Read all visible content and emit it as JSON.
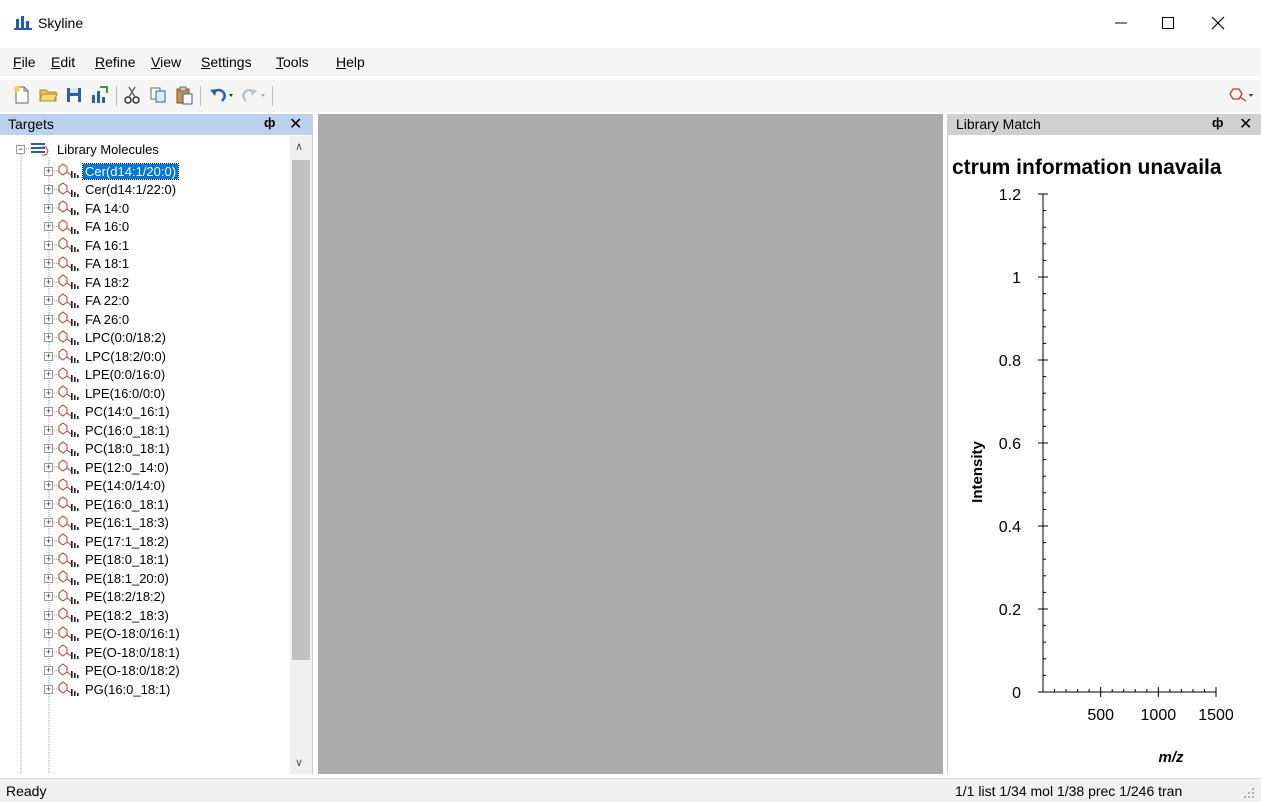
{
  "app": {
    "title": "Skyline"
  },
  "menu": [
    {
      "label": "File",
      "key": "F",
      "rest": "ile"
    },
    {
      "label": "Edit",
      "key": "E",
      "rest": "dit"
    },
    {
      "label": "Refine",
      "key": "R",
      "rest": "efine"
    },
    {
      "label": "View",
      "key": "V",
      "rest": "iew"
    },
    {
      "label": "Settings",
      "key": "S",
      "rest": "ettings"
    },
    {
      "label": "Tools",
      "key": "T",
      "rest": "ools"
    },
    {
      "label": "Help",
      "key": "H",
      "rest": "elp"
    }
  ],
  "toolbar": {
    "icons": [
      "new-document-icon",
      "open-folder-icon",
      "save-icon",
      "import-icon",
      "cut-icon",
      "copy-icon",
      "paste-icon",
      "undo-icon",
      "redo-icon",
      "molecule-mode-icon"
    ]
  },
  "targets_panel": {
    "title": "Targets",
    "pin": "ф",
    "close": "✕",
    "root_label": "Library Molecules",
    "items": [
      "Cer(d14:1/20:0)",
      "Cer(d14:1/22:0)",
      "FA 14:0",
      "FA 16:0",
      "FA 16:1",
      "FA 18:1",
      "FA 18:2",
      "FA 22:0",
      "FA 26:0",
      "LPC(0:0/18:2)",
      "LPC(18:2/0:0)",
      "LPE(0:0/16:0)",
      "LPE(16:0/0:0)",
      "PC(14:0_16:1)",
      "PC(16:0_18:1)",
      "PC(18:0_18:1)",
      "PE(12:0_14:0)",
      "PE(14:0/14:0)",
      "PE(16:0_18:1)",
      "PE(16:1_18:3)",
      "PE(17:1_18:2)",
      "PE(18:0_18:1)",
      "PE(18:1_20:0)",
      "PE(18:2/18:2)",
      "PE(18:2_18:3)",
      "PE(O-18:0/16:1)",
      "PE(O-18:0/18:1)",
      "PE(O-18:0/18:2)",
      "PG(16:0_18:1)"
    ],
    "selected_index": 0
  },
  "library_panel": {
    "title": "Library Match",
    "pin": "ф",
    "close": "✕"
  },
  "chart_data": {
    "type": "line",
    "title": "ctrum information unavaila",
    "xlabel": "m/z",
    "ylabel": "Intensity",
    "xlim": [
      0,
      1500
    ],
    "ylim": [
      0,
      1.2
    ],
    "xticks": [
      500,
      1000,
      1500
    ],
    "xtick_labels": [
      "500",
      "1000",
      "1500"
    ],
    "yticks": [
      0,
      0.2,
      0.4,
      0.6,
      0.8,
      1,
      1.2
    ],
    "ytick_labels": [
      "0",
      "0.2",
      "0.4",
      "0.6",
      "0.8",
      "1",
      "1.2"
    ],
    "series": []
  },
  "status": {
    "ready": "Ready",
    "counts": "1/1 list  1/34 mol  1/38 prec  1/246 tran"
  }
}
